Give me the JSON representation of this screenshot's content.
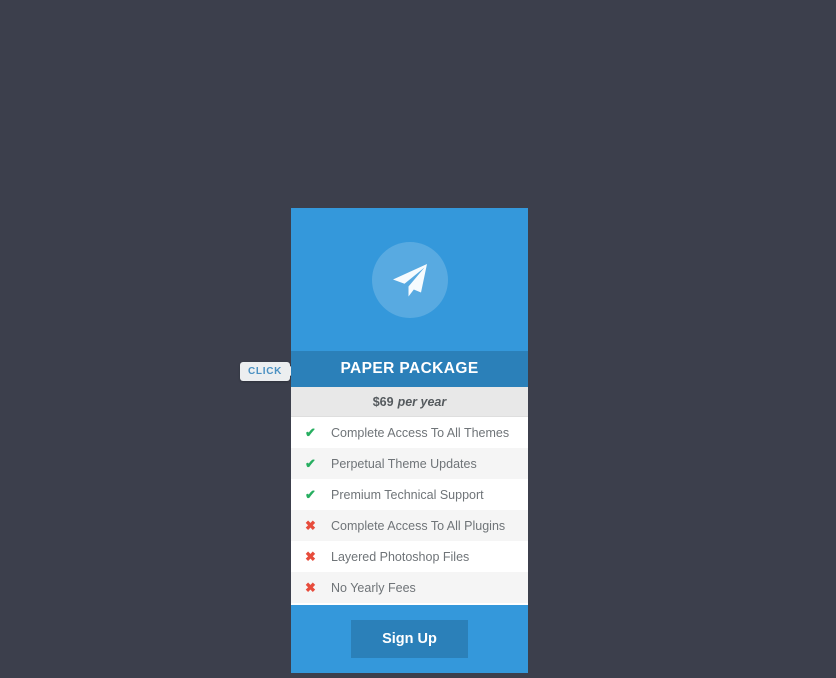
{
  "page": {
    "background_color": "#3c3f4c"
  },
  "click_hint": {
    "label": "CLICK",
    "text_color": "#4a90c2",
    "background_color": "#eceef0"
  },
  "card": {
    "icon": "paper-plane-icon",
    "header_color": "#3498db",
    "title": "PAPER PACKAGE",
    "title_bar_color": "#2b80b9",
    "price": {
      "amount": "$69",
      "period": "per year",
      "row_color": "#e8e8e8"
    },
    "features": [
      {
        "label": "Complete Access To All Themes",
        "included": true,
        "icon": "check-icon",
        "mark": "✔"
      },
      {
        "label": "Perpetual Theme Updates",
        "included": true,
        "icon": "check-icon",
        "mark": "✔"
      },
      {
        "label": "Premium Technical Support",
        "included": true,
        "icon": "check-icon",
        "mark": "✔"
      },
      {
        "label": "Complete Access To All Plugins",
        "included": false,
        "icon": "cross-icon",
        "mark": "✖"
      },
      {
        "label": "Layered Photoshop Files",
        "included": false,
        "icon": "cross-icon",
        "mark": "✖"
      },
      {
        "label": "No Yearly Fees",
        "included": false,
        "icon": "cross-icon",
        "mark": "✖"
      }
    ],
    "included_color": "#27ae60",
    "excluded_color": "#e74c3c",
    "footer": {
      "signup_label": "Sign Up",
      "button_color": "#2b80b9",
      "footer_color": "#3498db"
    }
  }
}
